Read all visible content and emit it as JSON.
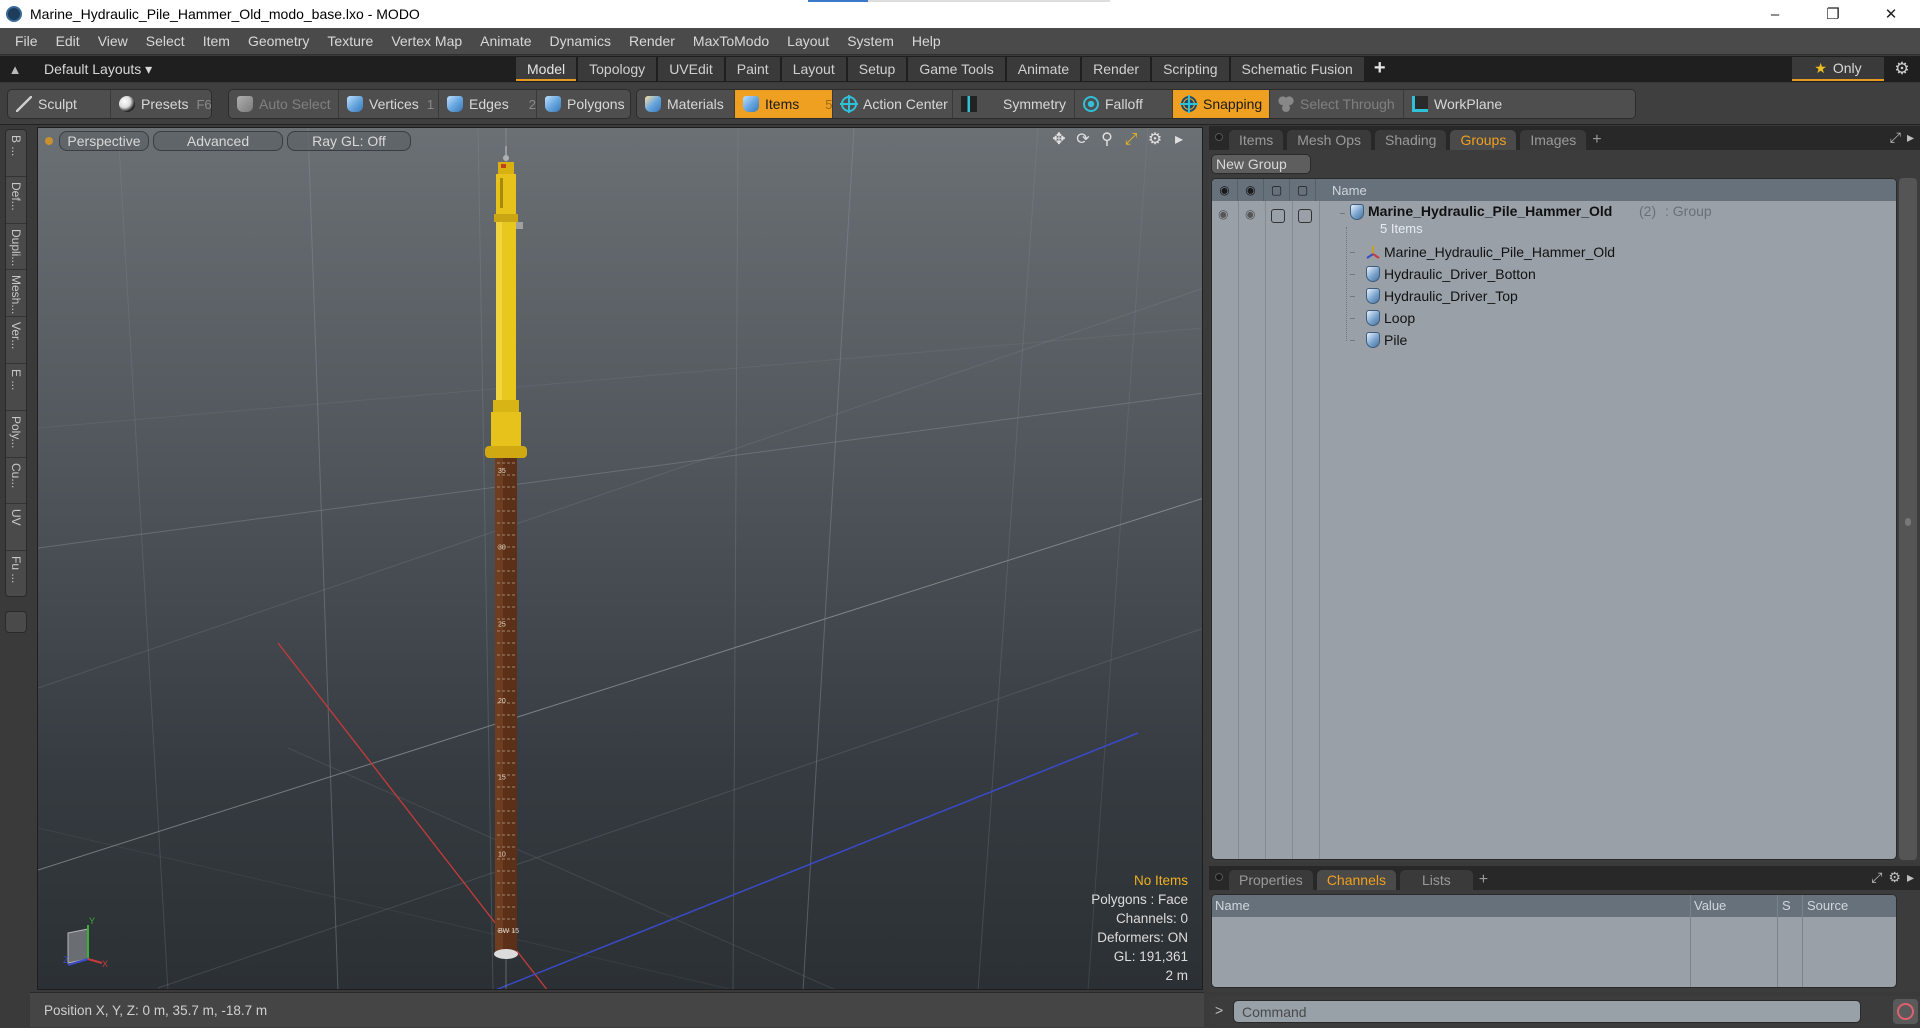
{
  "window": {
    "title": "Marine_Hydraulic_Pile_Hammer_Old_modo_base.lxo - MODO",
    "minimize": "–",
    "maximize": "❐",
    "close": "✕"
  },
  "menu": [
    "File",
    "Edit",
    "View",
    "Select",
    "Item",
    "Geometry",
    "Texture",
    "Vertex Map",
    "Animate",
    "Dynamics",
    "Render",
    "MaxToModo",
    "Layout",
    "System",
    "Help"
  ],
  "layout_bar": {
    "layouts_label": "Default Layouts ▾",
    "tabs": [
      "Model",
      "Topology",
      "UVEdit",
      "Paint",
      "Layout",
      "Setup",
      "Game Tools",
      "Animate",
      "Render",
      "Scripting",
      "Schematic Fusion"
    ],
    "active_tab": "Model",
    "add_label": "+",
    "only_label": "Only",
    "star": "★",
    "gear": "⚙"
  },
  "toolbar": {
    "sculpt": "Sculpt",
    "presets": "Presets",
    "presets_hotkey": "F6",
    "auto_select": "Auto Select",
    "vertices": "Vertices",
    "vertices_hotkey": "1",
    "edges": "Edges",
    "edges_hotkey": "2",
    "polygons": "Polygons",
    "materials": "Materials",
    "items": "Items",
    "items_hotkey": "5",
    "action_center": "Action Center",
    "symmetry": "Symmetry",
    "falloff": "Falloff",
    "snapping": "Snapping",
    "select_through": "Select Through",
    "workplane": "WorkPlane"
  },
  "left_tabs": [
    "B ...",
    "Def...",
    "Dupli...",
    "Mesh...",
    "Ver...",
    "E ...",
    "Poly...",
    "Cu...",
    "UV",
    "Fu ..."
  ],
  "viewport": {
    "view_mode": "Perspective",
    "shading": "Advanced",
    "raygl": "Ray GL: Off",
    "info": {
      "selection": "No Items",
      "polygons": "Polygons : Face",
      "channels": "Channels: 0",
      "deformers": "Deformers: ON",
      "gl": "GL: 191,361",
      "scale": "2 m"
    },
    "gizmo": {
      "x": "X",
      "y": "Y",
      "z": "Z"
    },
    "pile_marks": [
      "35",
      "30",
      "25",
      "20",
      "15",
      "10",
      "BW 15"
    ],
    "colors": {
      "hammer": "#e8c21a",
      "pile": "#6a3a1e",
      "x_axis": "#c83a3a",
      "z_axis": "#3a4ac8",
      "y_axis": "#3ab03a"
    }
  },
  "status": {
    "position": "Position X, Y, Z:   0 m, 35.7 m, -18.7 m"
  },
  "groups_panel": {
    "tabs": [
      "Items",
      "Mesh Ops",
      "Shading",
      "Groups",
      "Images"
    ],
    "active_tab": "Groups",
    "new_group": "New Group",
    "column_name": "Name",
    "group": {
      "name": "Marine_Hydraulic_Pile_Hammer_Old",
      "count": "(2)",
      "type": ": Group",
      "subtitle": "5 Items"
    },
    "items": [
      {
        "name": "Marine_Hydraulic_Pile_Hammer_Old",
        "icon": "locator-icon"
      },
      {
        "name": "Hydraulic_Driver_Botton",
        "icon": "mesh-icon"
      },
      {
        "name": "Hydraulic_Driver_Top",
        "icon": "mesh-icon"
      },
      {
        "name": "Loop",
        "icon": "mesh-icon"
      },
      {
        "name": "Pile",
        "icon": "mesh-icon"
      }
    ]
  },
  "channels_panel": {
    "tabs": [
      "Properties",
      "Channels",
      "Lists"
    ],
    "active_tab": "Channels",
    "columns": [
      "Name",
      "Value",
      "S",
      "Source"
    ]
  },
  "command": {
    "prompt": ">",
    "placeholder": "Command"
  },
  "accent_color": "#f0a020"
}
